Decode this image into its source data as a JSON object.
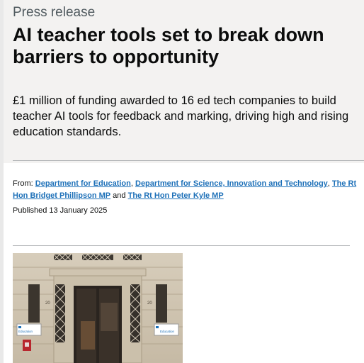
{
  "header": {
    "document_type": "Press release",
    "title": "AI teacher tools set to break down barriers to opportunity",
    "summary": "£1 million of funding awarded to 16 ed tech companies to build teacher AI tools for feedback and marking, driving high and rising education standards."
  },
  "metadata": {
    "from_label": "From:",
    "organisations": [
      "Department for Education",
      "Department for Science, Innovation and Technology",
      "The Rt Hon Bridget Phillipson MP",
      "The Rt Hon Peter Kyle MP"
    ],
    "separator_comma": ",",
    "separator_and": "and",
    "published": "Published 13 January 2025"
  },
  "image": {
    "sign_left": "Education",
    "sign_right": "Education",
    "door_number_left": "20",
    "door_number_right": "20"
  },
  "colors": {
    "link": "#1d70b8",
    "text": "#0b0c0c",
    "secondary_text": "#505a5f",
    "hero_background": "#f3f2f1"
  }
}
